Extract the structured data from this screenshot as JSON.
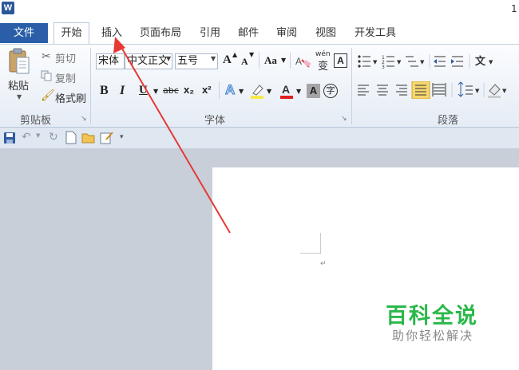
{
  "app": {
    "logo_letter": "W",
    "title_fragment": "1"
  },
  "tabs": [
    {
      "label": "文件"
    },
    {
      "label": "开始"
    },
    {
      "label": "插入"
    },
    {
      "label": "页面布局"
    },
    {
      "label": "引用"
    },
    {
      "label": "邮件"
    },
    {
      "label": "审阅"
    },
    {
      "label": "视图"
    },
    {
      "label": "开发工具"
    }
  ],
  "clipboard": {
    "paste_label": "粘贴",
    "cut_label": "剪切",
    "copy_label": "复制",
    "format_painter_label": "格式刷",
    "group_label": "剪贴板"
  },
  "font": {
    "font_name": "宋体",
    "font_name_alt": "中文正文",
    "font_size": "五号",
    "grow": "A",
    "shrink": "A",
    "change_case": "Aa",
    "bold": "B",
    "italic": "I",
    "underline": "U",
    "strike": "abc",
    "subscript": "x₂",
    "superscript": "x²",
    "phonetic_char": "变",
    "phonetic_top": "wén",
    "border_char": "A",
    "shade_char": "A",
    "enclose_char": "字",
    "group_label": "字体"
  },
  "paragraph": {
    "group_label": "段落"
  },
  "watermark": {
    "title": "百科全说",
    "subtitle": "助你轻松解决"
  },
  "colors": {
    "file_tab": "#2a5ea8",
    "arrow": "#e53935",
    "watermark": "#2bb84a",
    "highlight": "#f5d76e"
  }
}
